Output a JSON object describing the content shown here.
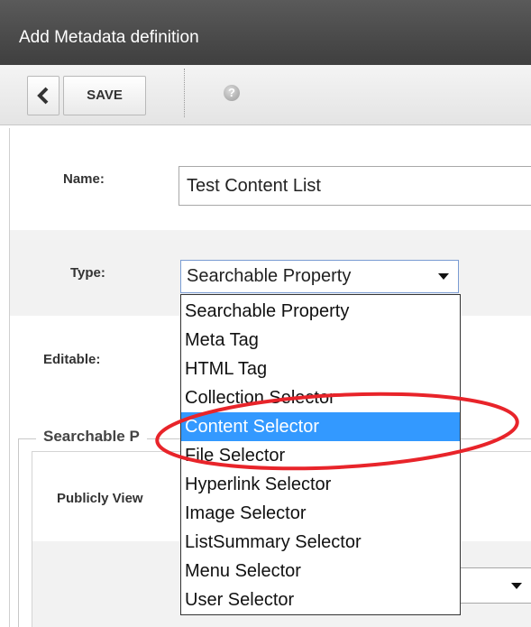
{
  "window": {
    "title": "Add Metadata definition"
  },
  "toolbar": {
    "back_icon": "chevron-left-icon",
    "save_label": "SAVE",
    "help_icon": "help-icon",
    "help_glyph": "?"
  },
  "form": {
    "name_label": "Name:",
    "name_value": "Test Content List",
    "type_label": "Type:",
    "type_selected": "Searchable Property",
    "editable_label": "Editable:"
  },
  "type_options": [
    "Searchable Property",
    "Meta Tag",
    "HTML Tag",
    "Collection Selector",
    "Content Selector",
    "File Selector",
    "Hyperlink Selector",
    "Image Selector",
    "ListSummary Selector",
    "Menu Selector",
    "User Selector"
  ],
  "highlighted_option": "Content Selector",
  "searchable_section": {
    "legend": "Searchable P",
    "publicly_viewable_label": "Publicly View"
  },
  "colors": {
    "titlebar": "#4a4a4a",
    "highlight": "#3399ff",
    "annotation_circle": "#e8242a"
  }
}
